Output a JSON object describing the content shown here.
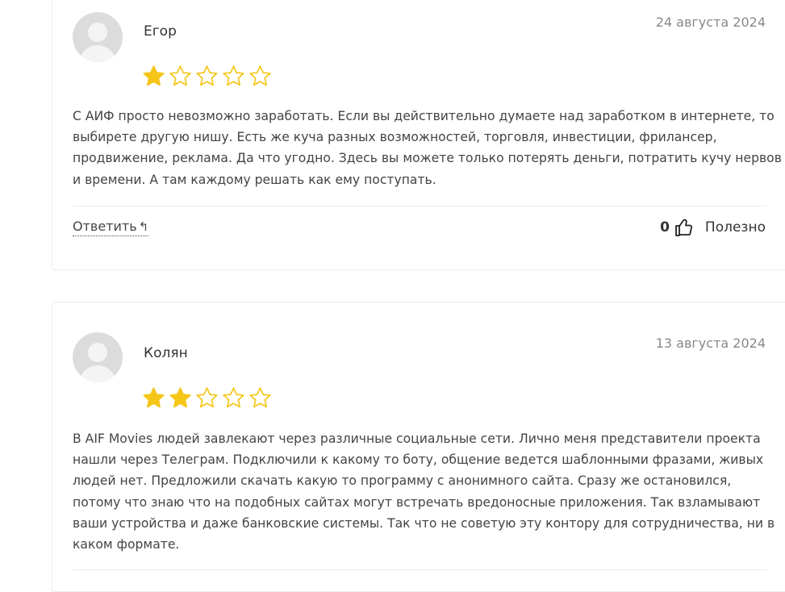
{
  "reviews": [
    {
      "author": "Егор",
      "date": "24 августа 2024",
      "rating": 1,
      "max_rating": 5,
      "text": "С АИФ просто невозможно заработать. Если вы действительно думаете над заработком в интернете, то выбирете другую нишу. Есть же куча разных возможностей, торговля, инвестиции, фрилансер, продвижение, реклама. Да что угодно. Здесь вы можете только потерять деньги, потратить кучу нервов и времени. А там каждому решать как ему поступать.",
      "reply_label": "Ответить",
      "reply_icon": "↰",
      "votes": "0",
      "helpful_label": "Полезно"
    },
    {
      "author": "Колян",
      "date": "13 августа 2024",
      "rating": 2,
      "max_rating": 5,
      "text": "В AIF Movies людей завлекают через различные социальные сети. Лично меня представители проекта нашли через Телеграм. Подключили к какому то боту, общение ведется шаблонными фразами, живых людей нет. Предложили скачать какую то программу с анонимного сайта. Сразу же остановился, потому что знаю что на подобных сайтах могут встречать вредоносные приложения. Так взламывают ваши устройства и даже банковские системы. Так что не советую эту контору для сотрудничества, ни в каком формате."
    }
  ],
  "colors": {
    "star_filled": "#f5c518",
    "star_empty": "#f5c518",
    "avatar_bg": "#dcdcdc",
    "date": "#888888"
  }
}
